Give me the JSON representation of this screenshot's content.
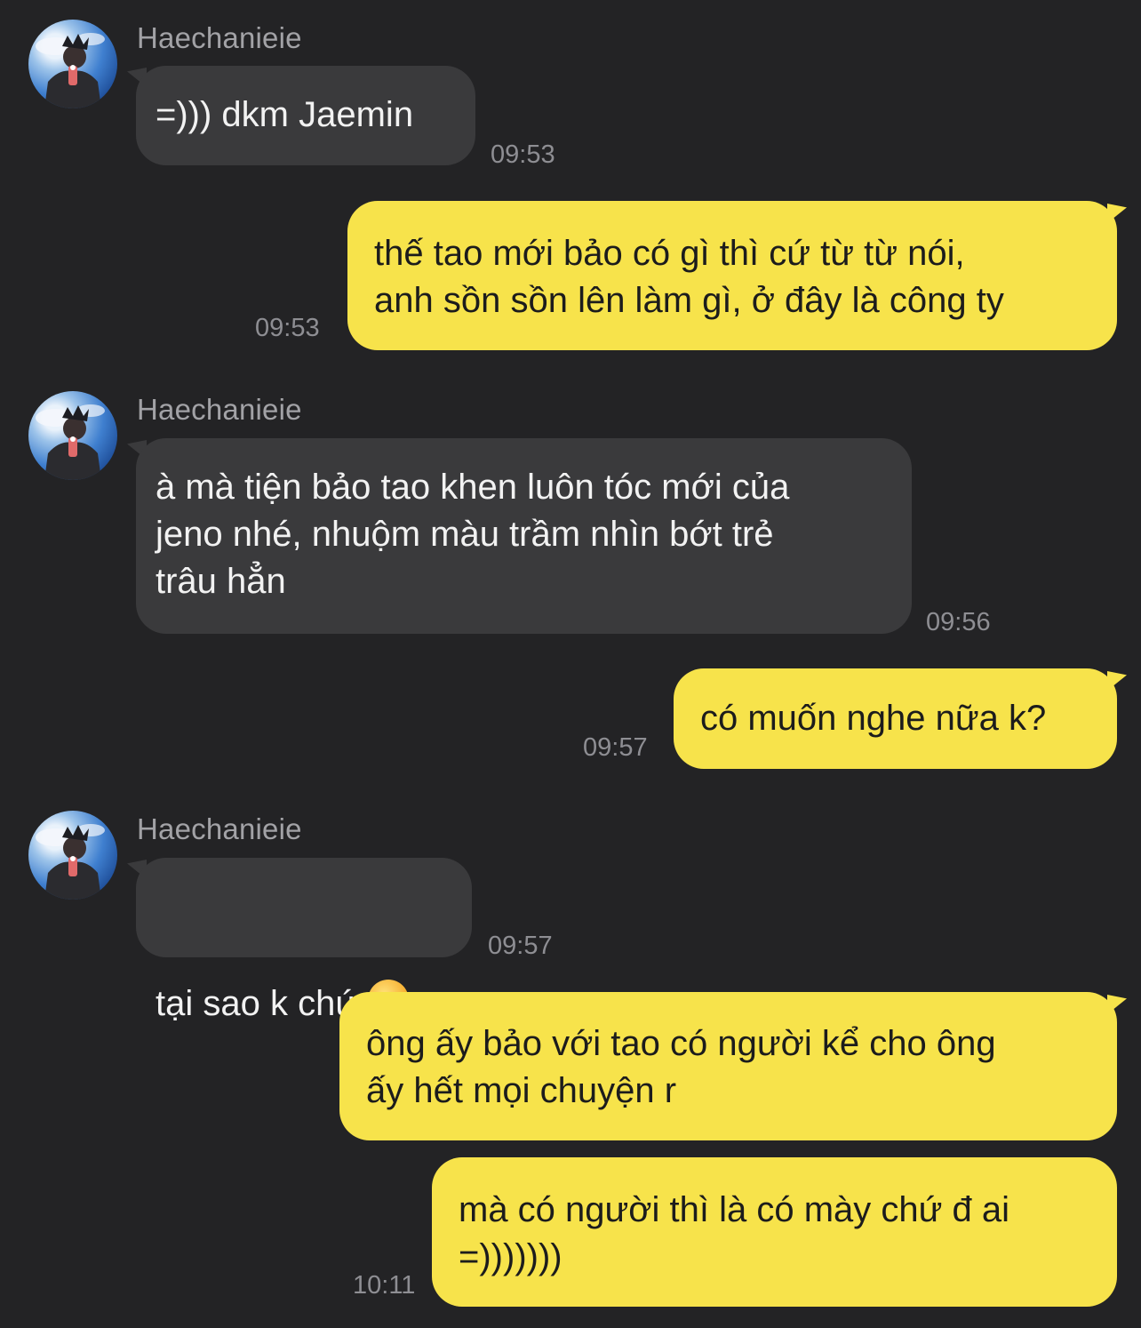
{
  "messages": [
    {
      "sender": "Haechanieie",
      "text": "=))) dkm Jaemin",
      "time": "09:53",
      "avatar": "avatar-icon"
    },
    {
      "text": "thế tao mới bảo có gì thì cứ từ từ nói,\nanh sồn sồn lên làm gì, ở đây là công ty",
      "time": "09:53"
    },
    {
      "sender": "Haechanieie",
      "text": "à mà tiện bảo tao khen luôn tóc mới của\njeno nhé, nhuộm màu trầm nhìn bớt trẻ\ntrâu hẳn",
      "time": "09:56",
      "avatar": "avatar-icon"
    },
    {
      "text": "có muốn nghe nữa k?",
      "time": "09:57"
    },
    {
      "sender": "Haechanieie",
      "text": "tại sao k chứ",
      "emoji": "yum-face-emoji",
      "time": "09:57",
      "avatar": "avatar-icon"
    },
    {
      "text": "ông ấy bảo với tao có người kể cho ông\nấy hết mọi chuyện r"
    },
    {
      "text": "mà có người thì là có mày chứ đ ai\n=)))))))",
      "time": "10:11"
    }
  ],
  "colors": {
    "background": "#232325",
    "incoming_bubble": "#3a3a3c",
    "outgoing_bubble": "#f7e34b",
    "timestamp": "#8e8e93",
    "sender_name": "#a2a2a6"
  }
}
